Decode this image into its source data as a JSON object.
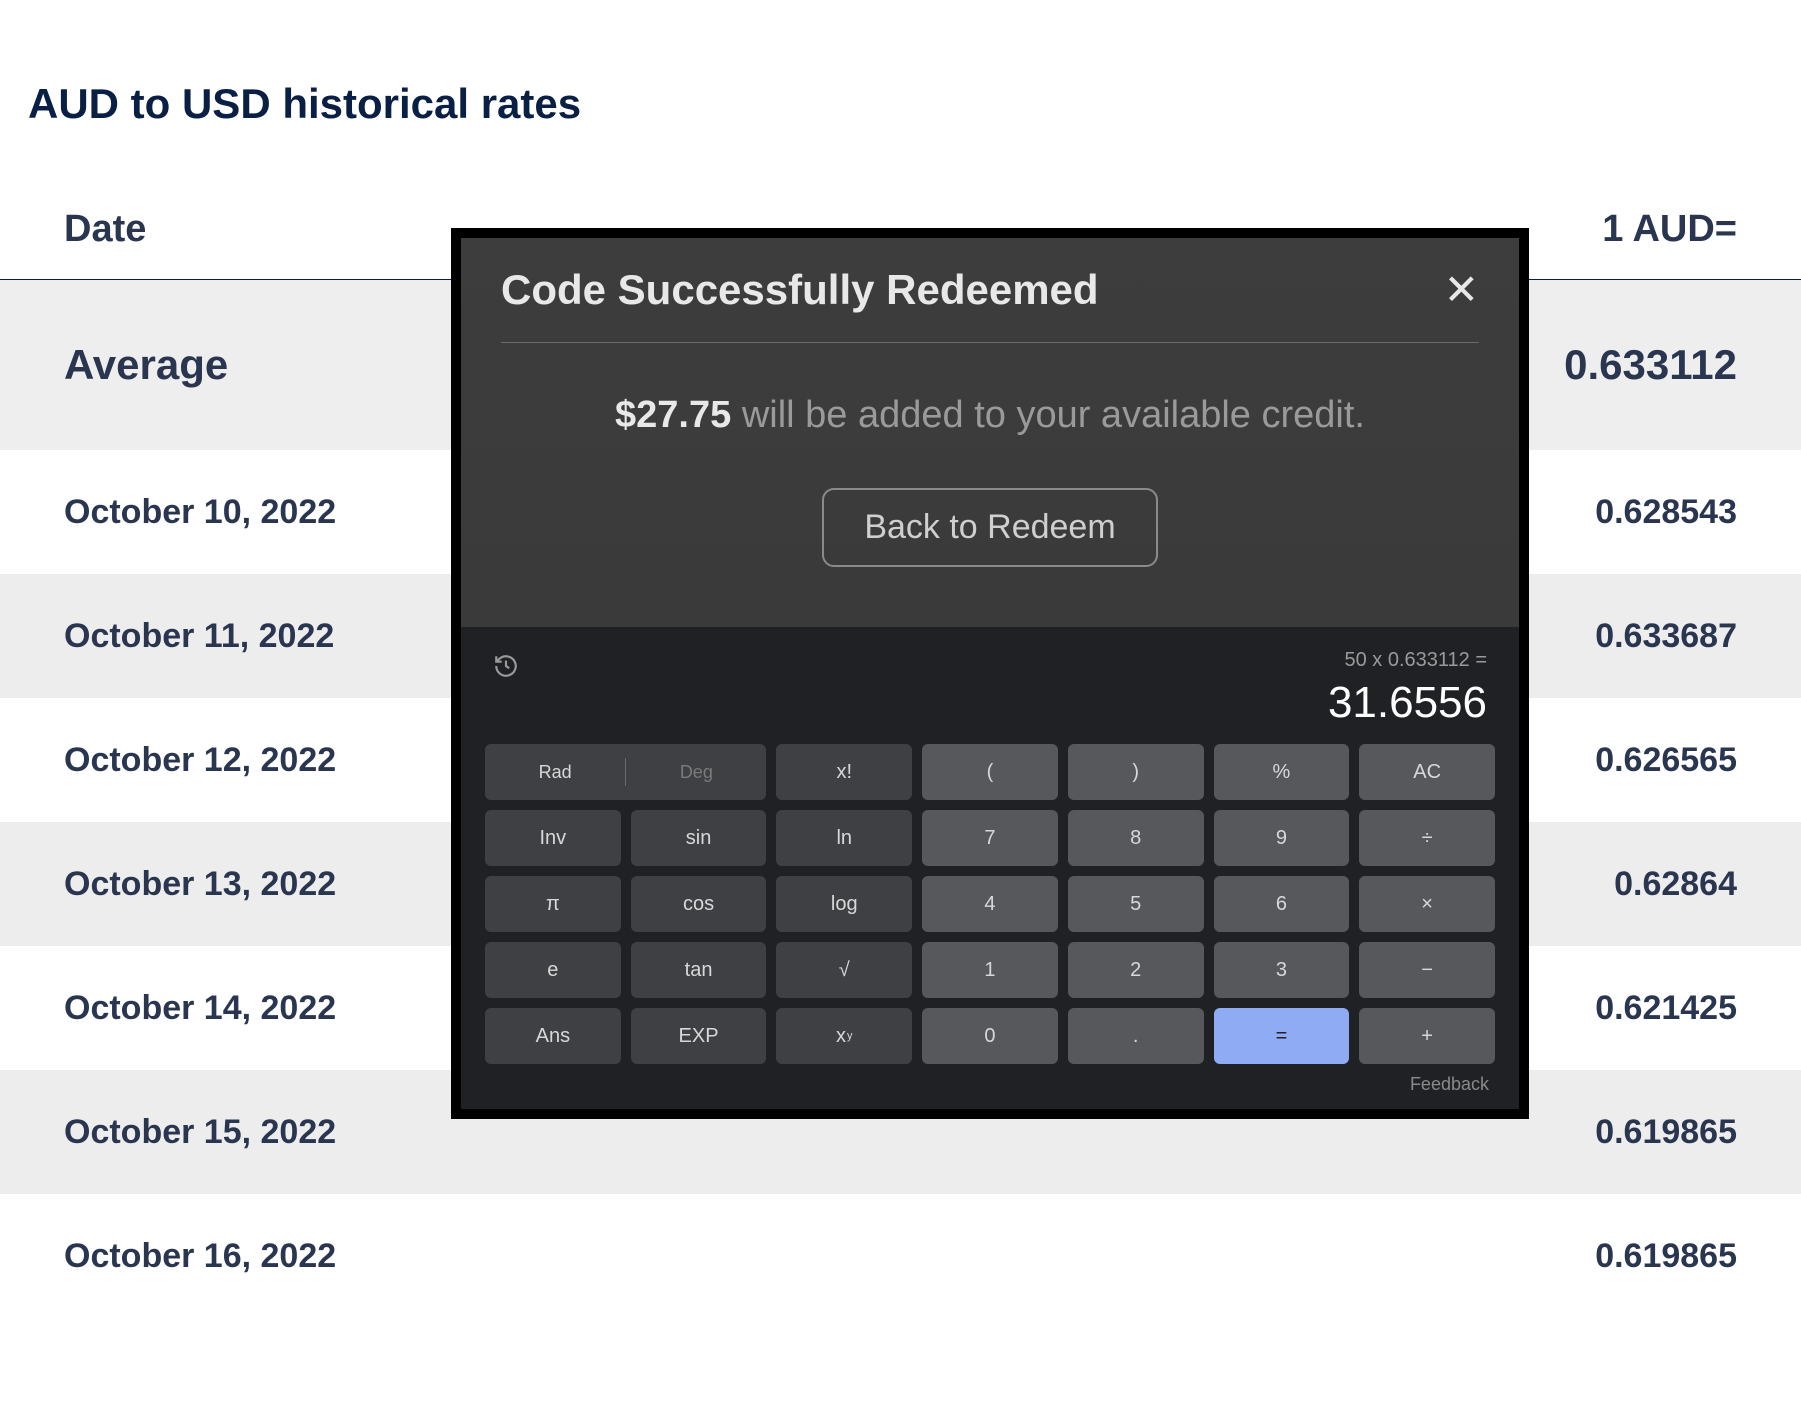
{
  "page": {
    "title": "AUD to USD historical rates"
  },
  "table": {
    "headers": {
      "date": "Date",
      "rate": "1 AUD="
    },
    "average": {
      "label": "Average",
      "value": "0.633112"
    },
    "rows": [
      {
        "date": "October 10, 2022",
        "value": "0.628543"
      },
      {
        "date": "October 11, 2022",
        "value": "0.633687"
      },
      {
        "date": "October 12, 2022",
        "value": "0.626565"
      },
      {
        "date": "October 13, 2022",
        "value": "0.62864"
      },
      {
        "date": "October 14, 2022",
        "value": "0.621425"
      },
      {
        "date": "October 15, 2022",
        "value": "0.619865"
      },
      {
        "date": "October 16, 2022",
        "value": "0.619865"
      }
    ]
  },
  "redeem": {
    "title": "Code Successfully Redeemed",
    "amount": "$27.75",
    "msg_part1": " will be added to your available credit.",
    "button": "Back to Redeem"
  },
  "calc": {
    "expression": "50 x 0.633112 =",
    "result": "31.6556",
    "keys": {
      "rad": "Rad",
      "deg": "Deg",
      "fact": "x!",
      "lparen": "(",
      "rparen": ")",
      "pct": "%",
      "ac": "AC",
      "inv": "Inv",
      "sin": "sin",
      "ln": "ln",
      "k7": "7",
      "k8": "8",
      "k9": "9",
      "div": "÷",
      "pi": "π",
      "cos": "cos",
      "log": "log",
      "k4": "4",
      "k5": "5",
      "k6": "6",
      "mul": "×",
      "e": "e",
      "tan": "tan",
      "sqrt": "√",
      "k1": "1",
      "k2": "2",
      "k3": "3",
      "sub": "−",
      "ans": "Ans",
      "exp": "EXP",
      "pow": "x",
      "powy": "y",
      "k0": "0",
      "dot": ".",
      "eq": "=",
      "add": "+",
      "feedback": "Feedback"
    }
  }
}
